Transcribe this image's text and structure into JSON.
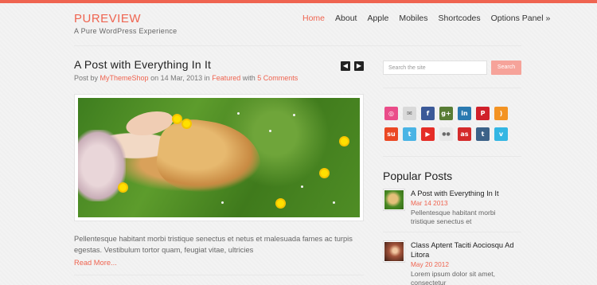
{
  "site": {
    "logo": "PUREVIEW",
    "tagline": "A Pure WordPress Experience"
  },
  "nav": {
    "items": [
      "Home",
      "About",
      "Apple",
      "Mobiles",
      "Shortcodes",
      "Options Panel »"
    ],
    "active": "Home"
  },
  "post": {
    "title": "A Post with Everything In It",
    "meta_prefix": "Post by",
    "author": "MyThemeShop",
    "meta_on": "on",
    "date": "14 Mar, 2013",
    "meta_in": "in",
    "category": "Featured",
    "meta_with": "with",
    "comments": "5 Comments",
    "excerpt": "Pellentesque habitant morbi tristique senectus et netus et malesuada fames ac turpis egestas. Vestibulum tortor quam, feugiat vitae, ultricies",
    "read_more": "Read More..."
  },
  "pager": {
    "prev_icon": "◀",
    "next_icon": "▶"
  },
  "search": {
    "placeholder": "Search the site",
    "button": "Search"
  },
  "social": [
    {
      "name": "dribbble-icon",
      "glyph": "◎",
      "color": "#ea4c89"
    },
    {
      "name": "email-icon",
      "glyph": "✉",
      "color": "#d9d9d9"
    },
    {
      "name": "facebook-icon",
      "glyph": "f",
      "color": "#3b5998"
    },
    {
      "name": "googleplus-icon",
      "glyph": "g+",
      "color": "#587d35"
    },
    {
      "name": "linkedin-icon",
      "glyph": "in",
      "color": "#2a7ab0"
    },
    {
      "name": "pinterest-icon",
      "glyph": "P",
      "color": "#d0202a"
    },
    {
      "name": "rss-icon",
      "glyph": ")",
      "color": "#f39323"
    },
    {
      "name": "stumbleupon-icon",
      "glyph": "su",
      "color": "#eb4823"
    },
    {
      "name": "twitter-icon",
      "glyph": "t",
      "color": "#4ab4e5"
    },
    {
      "name": "youtube-icon",
      "glyph": "▶",
      "color": "#e52d27"
    },
    {
      "name": "flickr-icon",
      "glyph": "●●",
      "color": "#e9e9e9"
    },
    {
      "name": "lastfm-icon",
      "glyph": "as",
      "color": "#d42b2b"
    },
    {
      "name": "tumblr-icon",
      "glyph": "t",
      "color": "#3c6288"
    },
    {
      "name": "vimeo-icon",
      "glyph": "v",
      "color": "#34b6e3"
    }
  ],
  "popular": {
    "heading": "Popular Posts",
    "items": [
      {
        "title": "A Post with Everything In It",
        "date": "Mar 14 2013",
        "excerpt": "Pellentesque habitant morbi tristique senectus et"
      },
      {
        "title": "Class Aptent Taciti Aociosqu Ad Litora",
        "date": "May 20 2012",
        "excerpt": "Lorem ipsum dolor sit amet, consectetur"
      }
    ]
  },
  "colors": {
    "accent": "#ef6450",
    "search_button": "#f6a39a"
  }
}
